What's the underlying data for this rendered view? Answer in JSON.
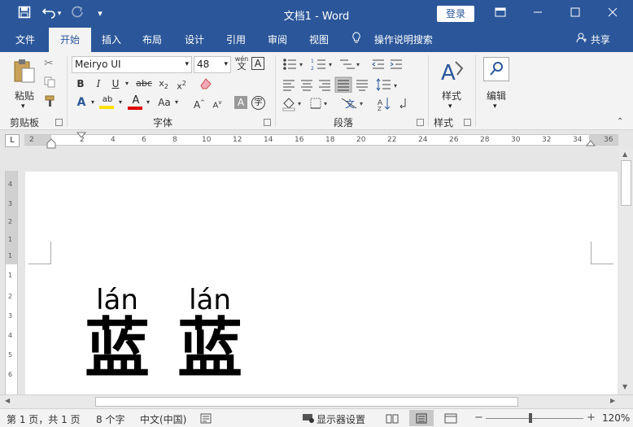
{
  "titlebar": {
    "doc_title": "文档1 - Word",
    "login": "登录",
    "save_icon": "save-icon",
    "undo_icon": "undo-icon",
    "redo_icon": "redo-icon",
    "customize_icon": "customize-qat-icon"
  },
  "tabs": [
    {
      "label": "文件"
    },
    {
      "label": "开始",
      "active": true
    },
    {
      "label": "插入"
    },
    {
      "label": "布局"
    },
    {
      "label": "设计"
    },
    {
      "label": "引用"
    },
    {
      "label": "审阅"
    },
    {
      "label": "视图"
    }
  ],
  "tellme": "操作说明搜索",
  "share": "共享",
  "ribbon": {
    "clipboard": {
      "paste": "粘贴",
      "label": "剪贴板"
    },
    "font": {
      "font_name": "Meiryo UI",
      "font_size": "48",
      "label": "字体",
      "phonetic": "wén",
      "aa": "Aa"
    },
    "paragraph": {
      "label": "段落"
    },
    "styles": {
      "button": "样式",
      "label": "样式"
    },
    "editing": {
      "button": "编辑"
    }
  },
  "ruler_numbers": [
    "2",
    "2",
    "4",
    "6",
    "8",
    "10",
    "12",
    "14",
    "16",
    "18",
    "20",
    "22",
    "24",
    "26",
    "28",
    "30",
    "32",
    "34",
    "36"
  ],
  "vruler_numbers": [
    "4",
    "3",
    "2",
    "1",
    "1",
    "1",
    "2",
    "3",
    "4",
    "5",
    "6"
  ],
  "document": {
    "words": [
      {
        "pinyin": "lán",
        "hanzi": "蓝"
      },
      {
        "pinyin": "lán",
        "hanzi": "蓝"
      }
    ]
  },
  "statusbar": {
    "page": "第 1 页，共 1 页",
    "words": "8 个字",
    "language": "中文(中国)",
    "display_settings": "显示器设置",
    "zoom": "120%"
  },
  "colors": {
    "accent": "#2b579a",
    "ribbon": "#f3f3f3"
  }
}
